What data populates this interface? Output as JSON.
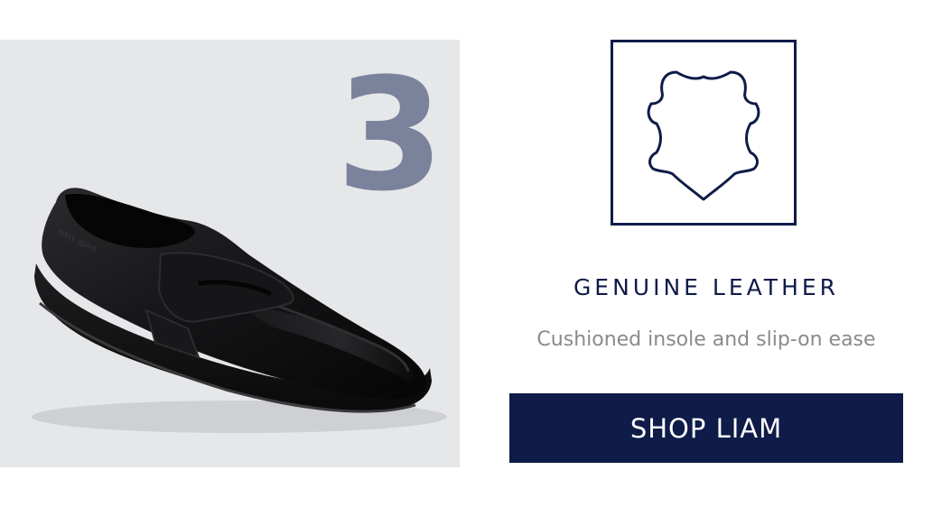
{
  "step": {
    "number": "3"
  },
  "product": {
    "image_alt": "Black leather penny loafer",
    "brand_emboss": "easy spirit"
  },
  "feature": {
    "icon": "leather-hide-icon",
    "title": "GENUINE LEATHER",
    "description": "Cushioned insole and slip-on ease"
  },
  "cta": {
    "label": "SHOP LIAM"
  },
  "colors": {
    "navy": "#0f1b48",
    "step_number": "#7b829c",
    "panel_bg": "#e6e7e9",
    "description_gray": "#8a8a8a"
  }
}
